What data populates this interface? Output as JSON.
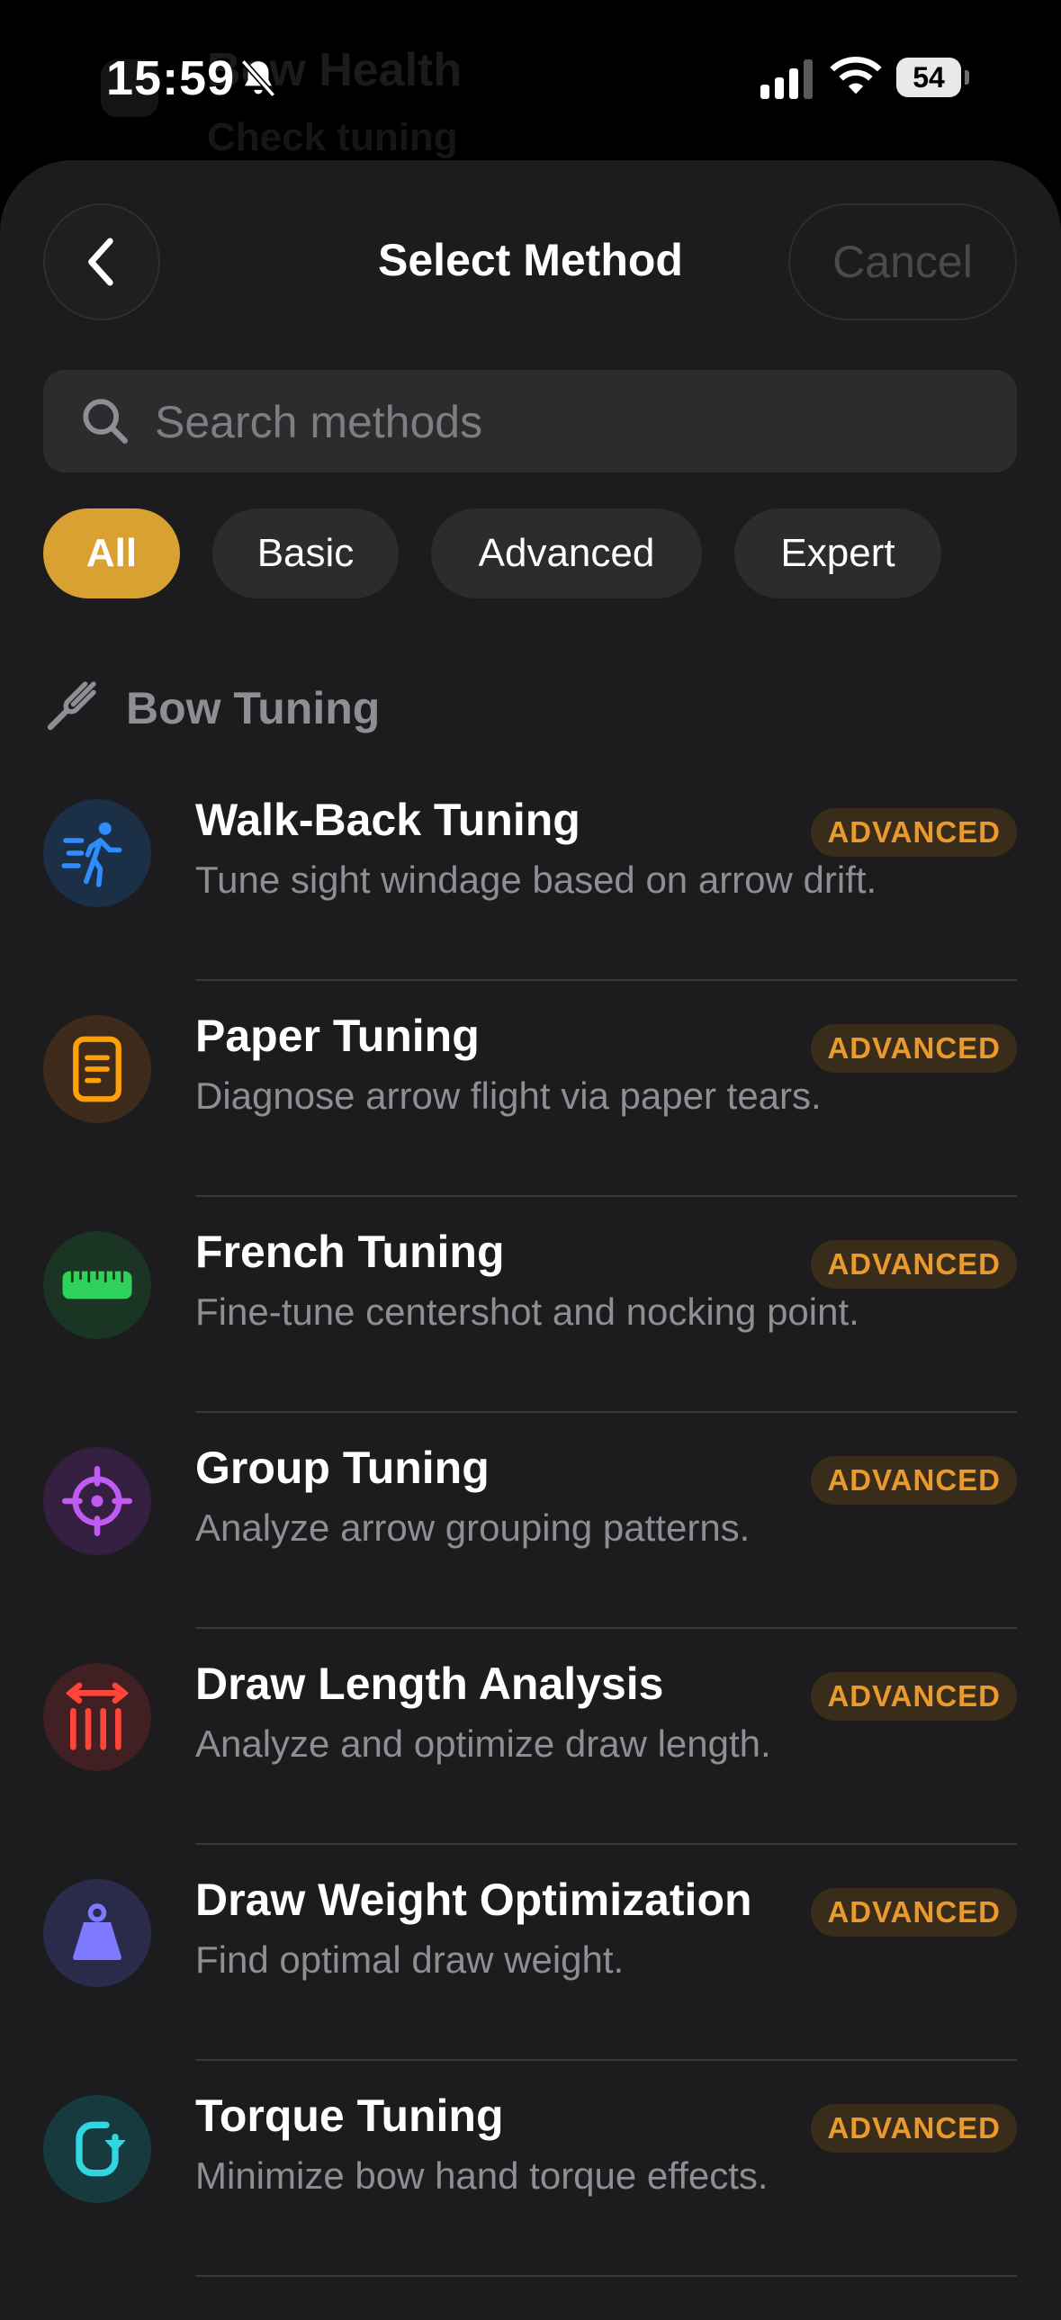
{
  "status_bar": {
    "time": "15:59",
    "battery": "54"
  },
  "background": {
    "title": "Bow Health",
    "subtitle": "Check tuning"
  },
  "header": {
    "title": "Select Method",
    "cancel_label": "Cancel"
  },
  "search": {
    "placeholder": "Search methods",
    "value": ""
  },
  "filters": [
    {
      "label": "All",
      "active": true
    },
    {
      "label": "Basic",
      "active": false
    },
    {
      "label": "Advanced",
      "active": false
    },
    {
      "label": "Expert",
      "active": false
    }
  ],
  "section": {
    "label": "Bow Tuning",
    "icon": "tuning-fork-icon"
  },
  "methods": [
    {
      "title": "Walk-Back Tuning",
      "description": "Tune sight windage based on arrow drift.",
      "badge": "ADVANCED",
      "icon": "walking-figure-icon",
      "color": "#2f8cff"
    },
    {
      "title": "Paper Tuning",
      "description": "Diagnose arrow flight via paper tears.",
      "badge": "ADVANCED",
      "icon": "document-icon",
      "color": "#ff9f0a"
    },
    {
      "title": "French Tuning",
      "description": "Fine-tune centershot and nocking point.",
      "badge": "ADVANCED",
      "icon": "ruler-icon",
      "color": "#30d158"
    },
    {
      "title": "Group Tuning",
      "description": "Analyze arrow grouping patterns.",
      "badge": "ADVANCED",
      "icon": "crosshair-icon",
      "color": "#bf5af2"
    },
    {
      "title": "Draw Length Analysis",
      "description": "Analyze and optimize draw length.",
      "badge": "ADVANCED",
      "icon": "measure-arrows-icon",
      "color": "#ff453a"
    },
    {
      "title": "Draw Weight Optimization",
      "description": "Find optimal draw weight.",
      "badge": "ADVANCED",
      "icon": "weight-icon",
      "color": "#7d7aff"
    },
    {
      "title": "Torque Tuning",
      "description": "Minimize bow hand torque effects.",
      "badge": "ADVANCED",
      "icon": "rotation-icon",
      "color": "#32d5e0"
    }
  ]
}
